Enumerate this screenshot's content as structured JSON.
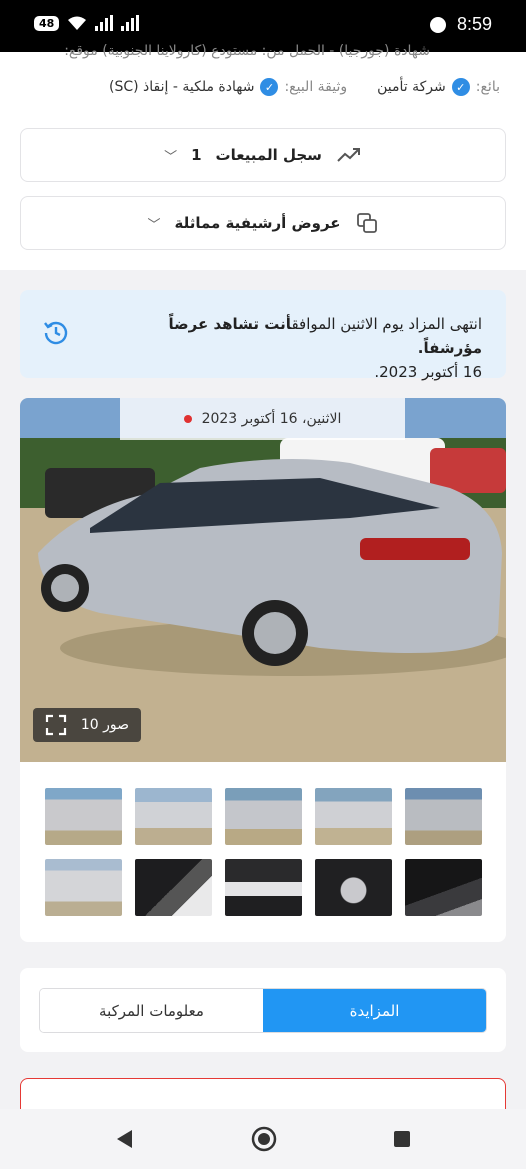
{
  "status_bar": {
    "time": "8:59",
    "battery": "48"
  },
  "top_info": {
    "line_partial": "شهادة (جورجيا) - الحمل من: مستودع (كارولاينا الجنوبية) موقع:",
    "document": {
      "label": "وثيقة البيع:",
      "value": "شهادة ملكية - إنقاذ (SC)"
    },
    "seller": {
      "label": "بائع:",
      "value": "شركة تأمين"
    }
  },
  "sales_history": {
    "label": "سجل المبيعات",
    "count": "1"
  },
  "archived": {
    "label": "عروض أرشيفية مماثلة"
  },
  "alert": {
    "text": "انتهى المزاد يوم الاثنين الموافق",
    "bold": "أنت تشاهد عرضاً مؤرشفاً.",
    "date": "16 أكتوبر 2023."
  },
  "gallery": {
    "date_label": "الاثنين، 16 أكتوبر 2023",
    "photos_count": "10 صور",
    "thumbnail_count": 10
  },
  "tabs": {
    "auction": "المزايدة",
    "vehicle_info": "معلومات المركبة"
  },
  "colors": {
    "accent": "#2196f3",
    "alert_bg": "#e5f1fb",
    "danger": "#e53935",
    "check": "#2f8de4"
  }
}
